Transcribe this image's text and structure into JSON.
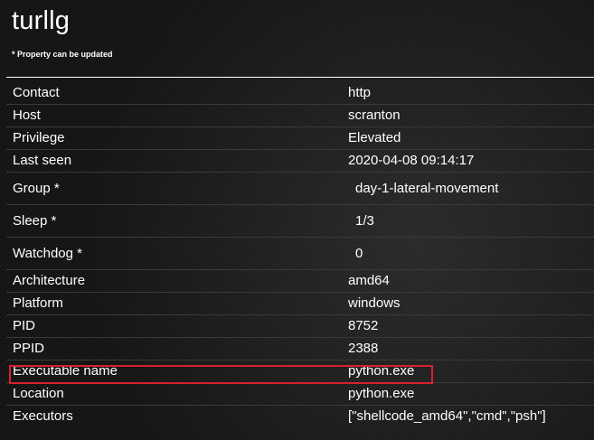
{
  "agent": {
    "title": "turllg",
    "note": "* Property can be updated"
  },
  "properties": [
    {
      "key": "Contact",
      "value": "http"
    },
    {
      "key": "Host",
      "value": "scranton"
    },
    {
      "key": "Privilege",
      "value": "Elevated"
    },
    {
      "key": "Last seen",
      "value": "2020-04-08 09:14:17"
    },
    {
      "key": "Group *",
      "value": "day-1-lateral-movement"
    },
    {
      "key": "Sleep *",
      "value": "1/3"
    },
    {
      "key": "Watchdog *",
      "value": "0"
    },
    {
      "key": "Architecture",
      "value": "amd64"
    },
    {
      "key": "Platform",
      "value": "windows"
    },
    {
      "key": "PID",
      "value": "8752"
    },
    {
      "key": "PPID",
      "value": "2388"
    },
    {
      "key": "Executable name",
      "value": "python.exe"
    },
    {
      "key": "Location",
      "value": "python.exe"
    },
    {
      "key": "Executors",
      "value": "[\"shellcode_amd64\",\"cmd\",\"psh\"]"
    }
  ],
  "highlight": {
    "row": "Executable name",
    "color": "#d6212e"
  }
}
